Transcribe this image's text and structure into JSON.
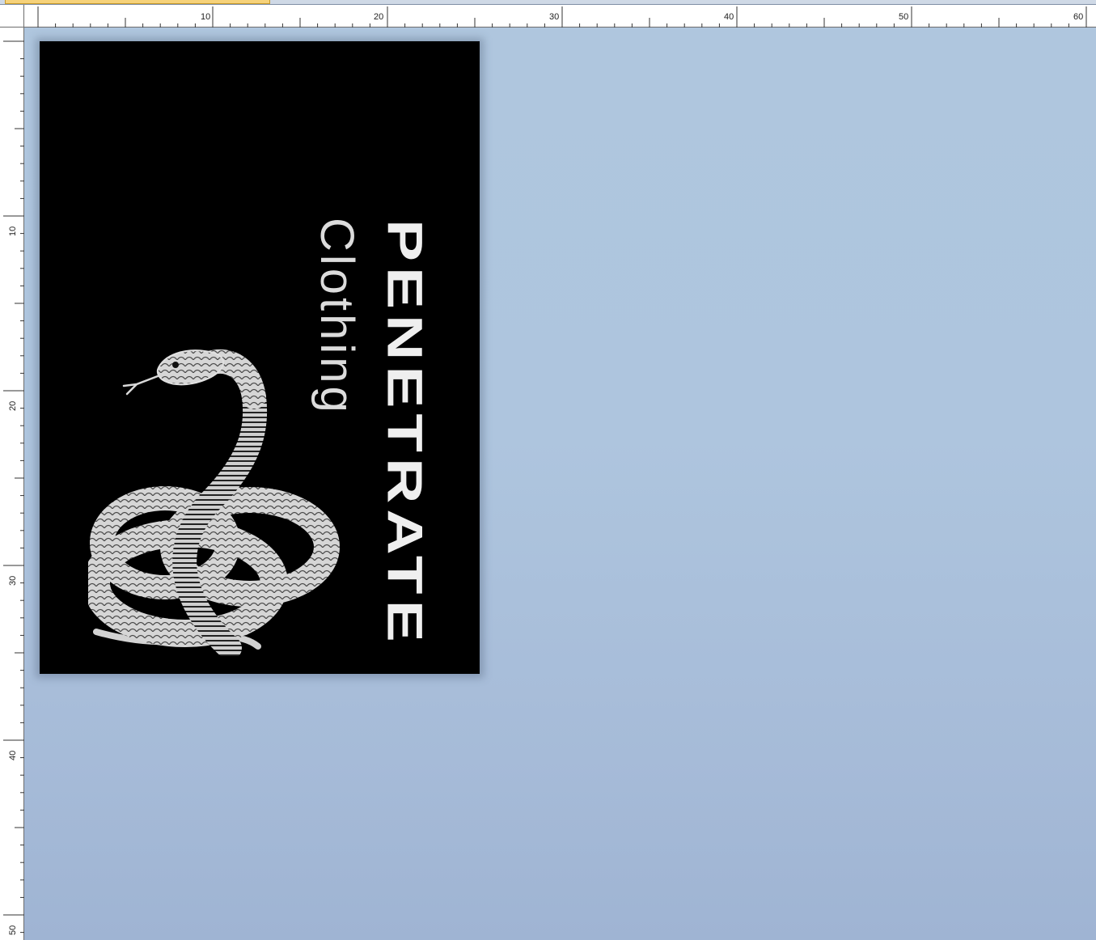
{
  "ruler": {
    "horizontal_labels": [
      "10",
      "20",
      "30",
      "40",
      "50",
      "60"
    ],
    "vertical_labels": [
      "10",
      "20",
      "30",
      "40",
      "50"
    ]
  },
  "document": {
    "brand_name": "PENETRATE",
    "brand_tagline": "Clothing",
    "artwork_icon": "coiled-snake-illustration"
  },
  "colors": {
    "workspace": "#a9bfda",
    "page_background": "#000000",
    "text": "#efefef",
    "active_tab": "#f6d27a"
  }
}
